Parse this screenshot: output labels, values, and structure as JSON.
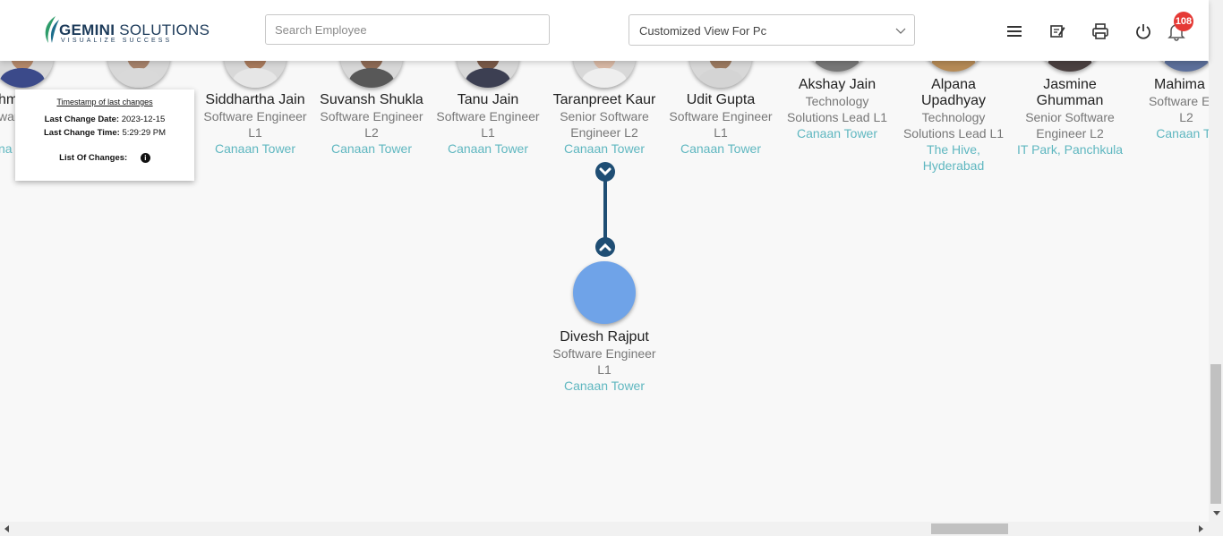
{
  "header": {
    "logo_main_bold": "GEMINI",
    "logo_main_rest": " SOLUTIONS",
    "logo_tagline": "VISUALIZE SUCCESS",
    "search_placeholder": "Search Employee",
    "view_select_value": "Customized View For Pc",
    "notification_count": "108",
    "icons": [
      "menu-icon",
      "edit-note-icon",
      "print-icon",
      "power-icon",
      "bell-icon"
    ]
  },
  "tooltip": {
    "title": "Timestamp of last changes",
    "date_label": "Last Change Date:",
    "date_value": "2023-12-15",
    "time_label": "Last Change Time:",
    "time_value": "5:29:29 PM",
    "changes_label": "List Of Changes:"
  },
  "employees": [
    {
      "name": "Siddhartha Jain",
      "role_lines": [
        "Software Engineer",
        "L1"
      ],
      "location": [
        "Canaan Tower"
      ]
    },
    {
      "name": "Suvansh Shukla",
      "role_lines": [
        "Software Engineer",
        "L2"
      ],
      "location": [
        "Canaan Tower"
      ]
    },
    {
      "name": "Tanu Jain",
      "role_lines": [
        "Software Engineer",
        "L1"
      ],
      "location": [
        "Canaan Tower"
      ]
    },
    {
      "name": "Taranpreet Kaur",
      "role_lines": [
        "Senior Software",
        "Engineer L2"
      ],
      "location": [
        "Canaan Tower"
      ]
    },
    {
      "name": "Udit Gupta",
      "role_lines": [
        "Software Engineer",
        "L1"
      ],
      "location": [
        "Canaan Tower"
      ]
    },
    {
      "name": "Akshay Jain",
      "role_lines": [
        "Technology",
        "Solutions Lead L1"
      ],
      "location": [
        "Canaan Tower"
      ]
    },
    {
      "name": "Alpana Upadhyay",
      "name_lines": [
        "Alpana",
        "Upadhyay"
      ],
      "role_lines": [
        "Technology",
        "Solutions Lead L1"
      ],
      "location": [
        "The Hive,",
        "Hyderabad"
      ]
    },
    {
      "name": "Jasmine Ghumman",
      "name_lines": [
        "Jasmine",
        "Ghumman"
      ],
      "role_lines": [
        "Senior Software",
        "Engineer L2"
      ],
      "location": [
        "IT Park, Panchkula"
      ]
    },
    {
      "name": "Mahima P",
      "role_lines": [
        "Software Eng",
        "L2"
      ],
      "location": [
        "Canaan To"
      ]
    }
  ],
  "partial_left": {
    "name": "hm",
    "role": "war",
    "loc": "na"
  },
  "child": {
    "name": "Divesh Rajput",
    "role_lines": [
      "Software Engineer",
      "L1"
    ],
    "location": "Canaan Tower",
    "avatar_color": "#6fa3e8"
  },
  "colors": {
    "accent": "#1f4e74",
    "location": "#5fb7c0",
    "badge": "#e53935"
  }
}
